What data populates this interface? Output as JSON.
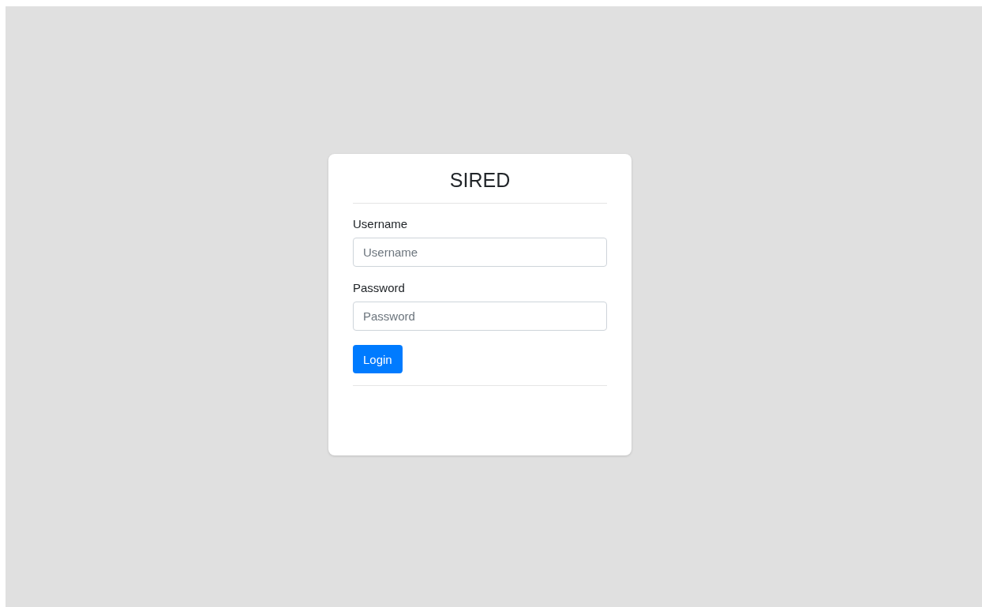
{
  "login_card": {
    "title": "SIRED",
    "fields": [
      {
        "label": "Username",
        "placeholder": "Username"
      },
      {
        "label": "Password",
        "placeholder": "Password"
      }
    ],
    "button": "Login"
  }
}
